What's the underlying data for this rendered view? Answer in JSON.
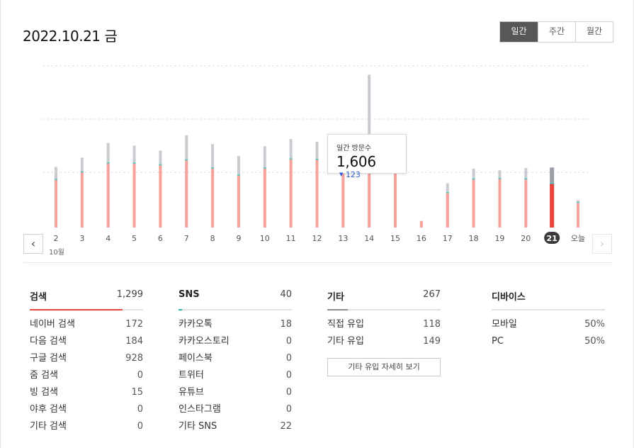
{
  "header": {
    "date": "2022.10.21 금"
  },
  "period_tabs": [
    {
      "label": "일간",
      "active": true
    },
    {
      "label": "주간",
      "active": false
    },
    {
      "label": "월간",
      "active": false
    }
  ],
  "chart_data": {
    "type": "bar",
    "categories": [
      "2",
      "3",
      "4",
      "5",
      "6",
      "7",
      "8",
      "9",
      "10",
      "11",
      "12",
      "13",
      "14",
      "15",
      "16",
      "17",
      "18",
      "19",
      "20",
      "21",
      "오늘"
    ],
    "series": [
      {
        "values": [
          870,
          1010,
          1170,
          1170,
          1140,
          1230,
          1080,
          950,
          1080,
          1250,
          1240,
          1110,
          1360,
          1380,
          120,
          630,
          880,
          890,
          880,
          800,
          450
        ]
      },
      {
        "values": [
          1110,
          1280,
          1550,
          1500,
          1410,
          1690,
          1530,
          1310,
          1490,
          1620,
          1570,
          1380,
          2800,
          1550,
          120,
          810,
          1080,
          1050,
          1090,
          1100,
          500
        ]
      }
    ],
    "colors": {
      "primary": "#f7a39b",
      "secondary": "#c8ccd0",
      "separator": "#4ac7bb",
      "selected": "#e8453c",
      "selected_secondary": "#9aa0a6"
    },
    "selected_index": 19,
    "ylim": [
      0,
      3000
    ],
    "grid": true,
    "month_label": "10월"
  },
  "tooltip": {
    "label": "일간 방문수",
    "value": "1,606",
    "diff": "123"
  },
  "stats": {
    "search": {
      "title": "검색",
      "total": "1,299",
      "share": 0.82,
      "color": "#e8453c",
      "rows": [
        {
          "label": "네이버 검색",
          "value": "172"
        },
        {
          "label": "다음 검색",
          "value": "184"
        },
        {
          "label": "구글 검색",
          "value": "928"
        },
        {
          "label": "줌 검색",
          "value": "0"
        },
        {
          "label": "빙 검색",
          "value": "15"
        },
        {
          "label": "야후 검색",
          "value": "0"
        },
        {
          "label": "기타 검색",
          "value": "0"
        }
      ]
    },
    "sns": {
      "title": "SNS",
      "total": "40",
      "share": 0.03,
      "color": "#26b9ad",
      "rows": [
        {
          "label": "카카오톡",
          "value": "18"
        },
        {
          "label": "카카오스토리",
          "value": "0"
        },
        {
          "label": "페이스북",
          "value": "0"
        },
        {
          "label": "트위터",
          "value": "0"
        },
        {
          "label": "유튜브",
          "value": "0"
        },
        {
          "label": "인스타그램",
          "value": "0"
        },
        {
          "label": "기타 SNS",
          "value": "22"
        }
      ]
    },
    "etc": {
      "title": "기타",
      "total": "267",
      "share": 0.18,
      "color": "#8f8f8f",
      "rows": [
        {
          "label": "직접 유입",
          "value": "118"
        },
        {
          "label": "기타 유입",
          "value": "149"
        }
      ],
      "button_label": "기타 유입 자세히 보기"
    },
    "device": {
      "title": "디바이스",
      "share": 0,
      "color": "#8f8f8f",
      "rows": [
        {
          "label": "모바일",
          "value": "50%"
        },
        {
          "label": "PC",
          "value": "50%"
        }
      ]
    }
  }
}
